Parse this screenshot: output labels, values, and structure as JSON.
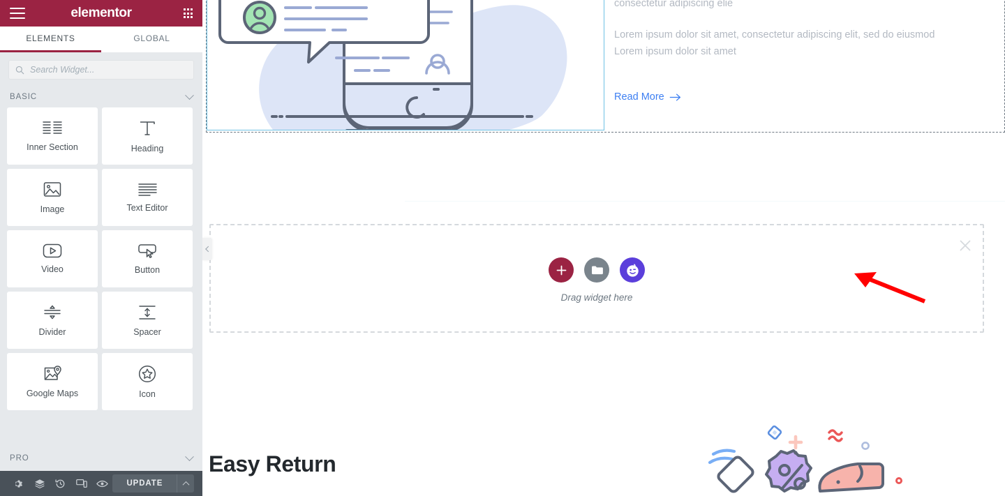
{
  "panel": {
    "header": {
      "brand": "elementor",
      "menu_icon": "hamburger-menu-icon",
      "apps_icon": "apps-grid-icon"
    },
    "tabs": [
      {
        "label": "ELEMENTS",
        "active": true
      },
      {
        "label": "GLOBAL",
        "active": false
      }
    ],
    "search": {
      "placeholder": "Search Widget...",
      "value": "",
      "icon": "search-icon"
    },
    "categories": [
      {
        "label": "BASIC",
        "expanded": true
      },
      {
        "label": "PRO",
        "expanded": false
      }
    ],
    "widgets": [
      {
        "label": "Inner Section",
        "icon": "inner-section-icon"
      },
      {
        "label": "Heading",
        "icon": "heading-t-icon"
      },
      {
        "label": "Image",
        "icon": "image-icon"
      },
      {
        "label": "Text Editor",
        "icon": "text-editor-icon"
      },
      {
        "label": "Video",
        "icon": "video-play-icon"
      },
      {
        "label": "Button",
        "icon": "button-cursor-icon"
      },
      {
        "label": "Divider",
        "icon": "divider-icon"
      },
      {
        "label": "Spacer",
        "icon": "spacer-icon"
      },
      {
        "label": "Google Maps",
        "icon": "google-maps-icon"
      },
      {
        "label": "Icon",
        "icon": "star-badge-icon"
      }
    ],
    "footer": {
      "icons": [
        {
          "name": "settings-gear-icon"
        },
        {
          "name": "navigator-layers-icon"
        },
        {
          "name": "history-revisions-icon"
        },
        {
          "name": "responsive-mode-icon"
        },
        {
          "name": "preview-eye-icon"
        }
      ],
      "update_label": "UPDATE",
      "caret_icon": "chevron-up-icon"
    }
  },
  "canvas": {
    "collapse_handle_icon": "chevron-left-icon",
    "section_one": {
      "image_widget": {
        "alt": "chat-bubble-phone-illustration"
      },
      "text": {
        "line_top": "consectetur adipiscing elie",
        "paragraph_line_1": "Lorem ipsum dolor sit amet, consectetur adipiscing elit, sed do eiusmod",
        "paragraph_line_2": "Lorem ipsum dolor sit amet",
        "read_more": "Read More",
        "read_more_arrow": "arrow-right-icon"
      }
    },
    "dropzone": {
      "label": "Drag widget here",
      "buttons": [
        {
          "name": "add-widget-button",
          "icon": "plus-icon",
          "color": "#9b2343"
        },
        {
          "name": "add-template-button",
          "icon": "folder-icon",
          "color": "#7a848c"
        },
        {
          "name": "ai-builder-button",
          "icon": "ai-face-icon",
          "color": "#5b3fdb"
        }
      ],
      "close_icon": "close-x-icon"
    },
    "section_three": {
      "title": "Easy Return",
      "illustration": "discount-tag-hand-illustration"
    }
  },
  "annotation": {
    "arrow": {
      "color": "#ff0000",
      "points_to": "ai-builder-button"
    }
  },
  "colors": {
    "brand_maroon": "#9b2343",
    "panel_bg": "#e6e9ec",
    "footer_bg": "#495159",
    "link_blue": "#3d7ff2",
    "ai_purple": "#5b3fdb",
    "annotation_red": "#ff0000"
  }
}
